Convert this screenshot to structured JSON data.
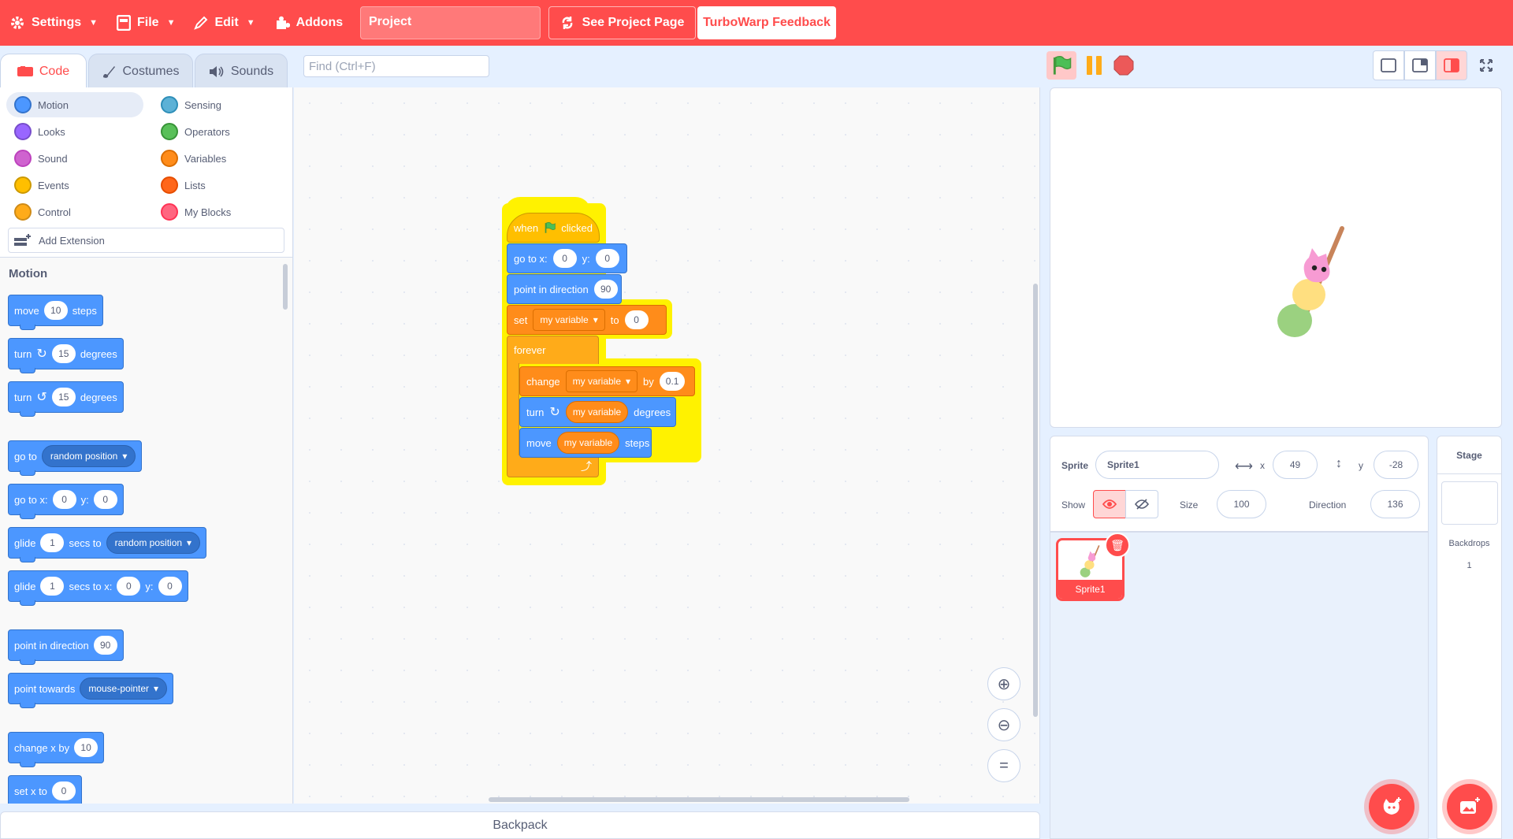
{
  "menubar": {
    "settings": "Settings",
    "file": "File",
    "edit": "Edit",
    "addons": "Addons",
    "project_title": "Project",
    "see_project": "See Project Page",
    "feedback": "TurboWarp Feedback"
  },
  "tabs": [
    {
      "label": "Code"
    },
    {
      "label": "Costumes"
    },
    {
      "label": "Sounds"
    }
  ],
  "find_placeholder": "Find (Ctrl+F)",
  "categories": [
    {
      "label": "Motion",
      "color": "#4c97ff"
    },
    {
      "label": "Looks",
      "color": "#9966ff"
    },
    {
      "label": "Sound",
      "color": "#cf63cf"
    },
    {
      "label": "Events",
      "color": "#ffbf00"
    },
    {
      "label": "Control",
      "color": "#ffab19"
    },
    {
      "label": "Sensing",
      "color": "#5cb1d6"
    },
    {
      "label": "Operators",
      "color": "#59c059"
    },
    {
      "label": "Variables",
      "color": "#ff8c1a"
    },
    {
      "label": "Lists",
      "color": "#ff661a"
    },
    {
      "label": "My Blocks",
      "color": "#ff6680"
    }
  ],
  "add_extension": "Add Extension",
  "palette": {
    "title": "Motion",
    "move": {
      "a": "move",
      "n": "10",
      "b": "steps"
    },
    "turn_right": {
      "a": "turn",
      "n": "15",
      "b": "degrees"
    },
    "turn_left": {
      "a": "turn",
      "n": "15",
      "b": "degrees"
    },
    "goto": {
      "a": "go to",
      "menu": "random position"
    },
    "gotoxy": {
      "a": "go to x:",
      "x": "0",
      "b": "y:",
      "y": "0"
    },
    "glide": {
      "a": "glide",
      "n": "1",
      "b": "secs to",
      "menu": "random position"
    },
    "glidexy": {
      "a": "glide",
      "n": "1",
      "b": "secs to x:",
      "x": "0",
      "c": "y:",
      "y": "0"
    },
    "point_dir": {
      "a": "point in direction",
      "n": "90"
    },
    "point_towards": {
      "a": "point towards",
      "menu": "mouse-pointer"
    },
    "change_x": {
      "a": "change x by",
      "n": "10"
    },
    "set_x": {
      "a": "set x to",
      "n": "0"
    }
  },
  "script": {
    "hat": {
      "a": "when",
      "b": "clicked"
    },
    "gotoxy": {
      "a": "go to x:",
      "x": "0",
      "b": "y:",
      "y": "0"
    },
    "point_dir": {
      "a": "point in direction",
      "n": "90"
    },
    "set_var": {
      "a": "set",
      "var": "my variable",
      "b": "to",
      "n": "0"
    },
    "forever": "forever",
    "change_var": {
      "a": "change",
      "var": "my variable",
      "b": "by",
      "n": "0.1"
    },
    "turn": {
      "a": "turn",
      "var": "my variable",
      "b": "degrees"
    },
    "move": {
      "a": "move",
      "var": "my variable",
      "b": "steps"
    }
  },
  "sprite_info": {
    "sprite_label": "Sprite",
    "sprite_name": "Sprite1",
    "x_label": "x",
    "x": "49",
    "y_label": "y",
    "y": "-28",
    "show_label": "Show",
    "size_label": "Size",
    "size": "100",
    "direction_label": "Direction",
    "direction": "136"
  },
  "sprites": [
    {
      "name": "Sprite1"
    }
  ],
  "stage_pane": {
    "title": "Stage",
    "backdrops_label": "Backdrops",
    "backdrops_count": "1"
  },
  "backpack": "Backpack",
  "colors": {
    "brand": "#ff4c4c",
    "motion": "#4c97ff",
    "variables": "#ff8c1a",
    "control": "#ffab19",
    "events": "#ffbf00"
  }
}
